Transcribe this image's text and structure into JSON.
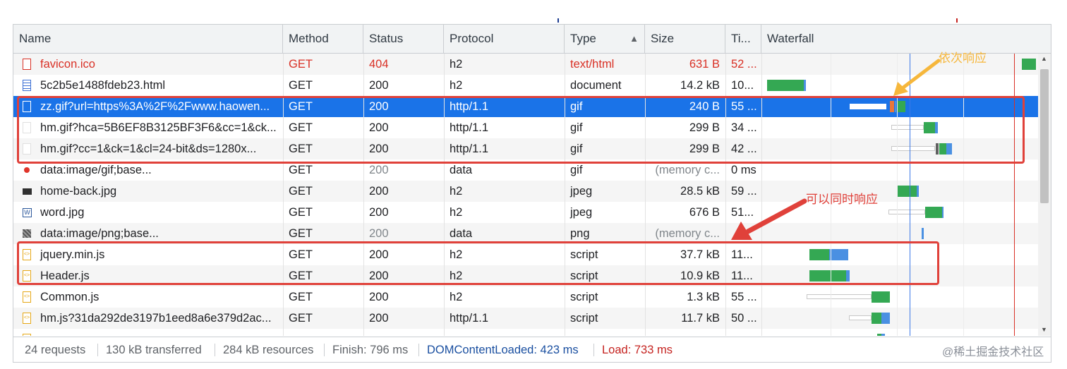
{
  "columns": {
    "name": "Name",
    "method": "Method",
    "status": "Status",
    "protocol": "Protocol",
    "type": "Type",
    "size": "Size",
    "time": "Ti...",
    "waterfall": "Waterfall"
  },
  "sort_icon": "sort-ascending-icon",
  "rows": [
    {
      "name": "favicon.ico",
      "method": "GET",
      "status": "404",
      "protocol": "h2",
      "type": "text/html",
      "size": "631 B",
      "time": "52 ...",
      "icon": "error-file-icon",
      "state": "error"
    },
    {
      "name": "5c2b5e1488fdeb23.html",
      "method": "GET",
      "status": "200",
      "protocol": "h2",
      "type": "document",
      "size": "14.2 kB",
      "time": "10...",
      "icon": "document-icon",
      "state": "normal"
    },
    {
      "name": "zz.gif?url=https%3A%2F%2Fwww.haowen...",
      "method": "GET",
      "status": "200",
      "protocol": "http/1.1",
      "type": "gif",
      "size": "240 B",
      "time": "55 ...",
      "icon": "image-file-icon",
      "state": "selected"
    },
    {
      "name": "hm.gif?hca=5B6EF8B3125BF3F6&cc=1&ck...",
      "method": "GET",
      "status": "200",
      "protocol": "http/1.1",
      "type": "gif",
      "size": "299 B",
      "time": "34 ...",
      "icon": "image-file-icon",
      "state": "normal"
    },
    {
      "name": "hm.gif?cc=1&ck=1&cl=24-bit&ds=1280x...",
      "method": "GET",
      "status": "200",
      "protocol": "http/1.1",
      "type": "gif",
      "size": "299 B",
      "time": "42 ...",
      "icon": "image-file-icon",
      "state": "normal"
    },
    {
      "name": "data:image/gif;base...",
      "method": "GET",
      "status": "200",
      "protocol": "data",
      "type": "gif",
      "size": "(memory c...",
      "time": "0 ms",
      "icon": "red-dot-image-icon",
      "state": "dim"
    },
    {
      "name": "home-back.jpg",
      "method": "GET",
      "status": "200",
      "protocol": "h2",
      "type": "jpeg",
      "size": "28.5 kB",
      "time": "59 ...",
      "icon": "image-thumbnail-icon",
      "state": "normal"
    },
    {
      "name": "word.jpg",
      "method": "GET",
      "status": "200",
      "protocol": "h2",
      "type": "jpeg",
      "size": "676 B",
      "time": "51...",
      "icon": "word-image-icon",
      "state": "normal"
    },
    {
      "name": "data:image/png;base...",
      "method": "GET",
      "status": "200",
      "protocol": "data",
      "type": "png",
      "size": "(memory c...",
      "time": "",
      "icon": "png-thumbnail-icon",
      "state": "dim"
    },
    {
      "name": "jquery.min.js",
      "method": "GET",
      "status": "200",
      "protocol": "h2",
      "type": "script",
      "size": "37.7 kB",
      "time": "11...",
      "icon": "script-file-icon",
      "state": "normal"
    },
    {
      "name": "Header.js",
      "method": "GET",
      "status": "200",
      "protocol": "h2",
      "type": "script",
      "size": "10.9 kB",
      "time": "11...",
      "icon": "script-file-icon",
      "state": "normal"
    },
    {
      "name": "Common.js",
      "method": "GET",
      "status": "200",
      "protocol": "h2",
      "type": "script",
      "size": "1.3 kB",
      "time": "55 ...",
      "icon": "script-file-icon",
      "state": "normal"
    },
    {
      "name": "hm.js?31da292de3197b1eed8a6e379d2ac...",
      "method": "GET",
      "status": "200",
      "protocol": "http/1.1",
      "type": "script",
      "size": "11.7 kB",
      "time": "50 ...",
      "icon": "script-file-icon",
      "state": "normal"
    },
    {
      "name": "",
      "method": "",
      "status": "",
      "protocol": "",
      "type": "",
      "size": "",
      "time": "",
      "icon": "script-file-icon",
      "state": "partial"
    }
  ],
  "status_bar": {
    "requests": "24 requests",
    "transferred": "130 kB transferred",
    "resources": "284 kB resources",
    "finish": "Finish: 796 ms",
    "dom_content_loaded": "DOMContentLoaded: 423 ms",
    "load": "Load: 733 ms"
  },
  "annotations": {
    "sequential": "依次响应",
    "parallel": "可以同时响应"
  },
  "watermark": "@稀土掘金技术社区",
  "colors": {
    "selected_row": "#1a73e8",
    "error_text": "#d93025",
    "dom_content_loaded": "#1a4fa0",
    "load": "#c5221f",
    "annotation_box": "#e0413a",
    "sequential_arrow": "#f6b73c",
    "parallel_arrow": "#e0413a",
    "bar_receiving": "#34a853",
    "bar_download": "#4a90e2",
    "bar_waiting": "#ffffff"
  }
}
